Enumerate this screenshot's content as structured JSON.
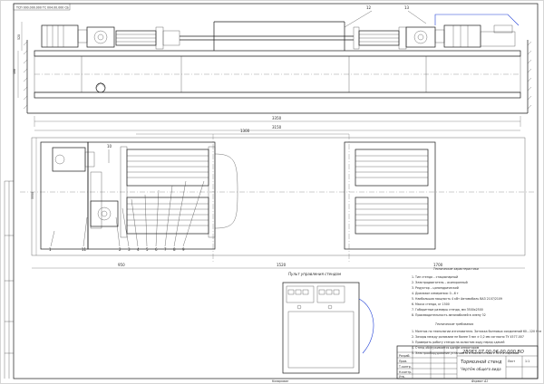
{
  "drawing": {
    "top_stamp": "ТСП 000.000.000 ТС 004.00.000 СБ",
    "title_block": {
      "code": "28083.07.00.06.00.000.ВО",
      "name_line1": "Тормозной стенд",
      "name_line2": "Чертёж общего вида",
      "scale": "1:1",
      "format": "Формат  А1",
      "copied": "Копировал",
      "sheet_label": "Лист",
      "role_1": "Разраб.",
      "role_2": "Пров.",
      "role_3": "Т.контр.",
      "role_4": "Н.контр.",
      "role_5": "Утв."
    },
    "console_title": "Пульт управления стендом",
    "tech_title_1": "Технические характеристики",
    "tech_items_1": [
      "1. Тип стенда – стационарный",
      "2. Электродвигатель – асинхронный",
      "3. Редуктор – цилиндрический",
      "4. Диапазон измерения: 0...6 т",
      "5. Наибольшая мощность 4 кВт Автомобиль ВАЗ 2107/2109",
      "6. Масса стенда, кг                                   1500",
      "7. Габаритные размеры стенда, мм   3500x2500",
      "8. Производительность автомобилей в смену       32"
    ],
    "tech_title_2": "Технические требования",
    "tech_items_2": [
      "1. Монтаж по технологии изготовителя. Затяжка болтовых соединений 60...120 Н·м",
      "2. Зазоры между роликами не более 5 мм ± 0,2 мм согласно ТУ 4577-007",
      "3. Проверить работу стенда на холостом ходу перед сдачей",
      "4. Стенд обслуживается одним оператором",
      "5. Электрооборудование установить в соответствии с ПУЭ и нормами"
    ],
    "dims": {
      "d1": "3350",
      "d2": "3150",
      "d3": "1300",
      "d4": "186",
      "d5": "950",
      "d6": "1520",
      "d7": "1700",
      "d8": "3350",
      "d9": "520"
    },
    "callouts": [
      "1",
      "2",
      "3",
      "4",
      "5",
      "6",
      "7",
      "8",
      "9",
      "10",
      "11",
      "12",
      "13"
    ]
  }
}
